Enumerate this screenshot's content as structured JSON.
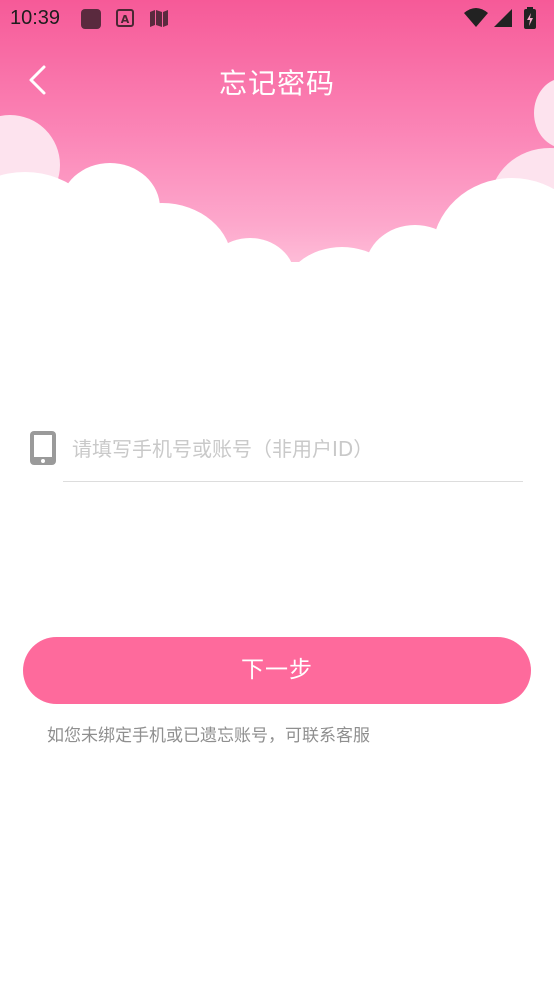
{
  "status_bar": {
    "time": "10:39",
    "icons": [
      "app-square-icon",
      "font-a-icon",
      "book-icon",
      "wifi-icon",
      "signal-icon",
      "battery-charging-icon"
    ]
  },
  "nav": {
    "title": "忘记密码",
    "back_icon": "chevron-left-icon"
  },
  "form": {
    "phone_placeholder": "请填写手机号或账号（非用户ID）",
    "phone_value": "",
    "field_icon": "phone-icon"
  },
  "actions": {
    "next_label": "下一步"
  },
  "footer": {
    "help_text": "如您未绑定手机或已遗忘账号，可联系客服"
  },
  "colors": {
    "header_top": "#f65a98",
    "header_bottom": "#fda8cc",
    "button": "#fe6a9c",
    "placeholder": "#c9c9c9",
    "help_text": "#8f8f8f"
  }
}
